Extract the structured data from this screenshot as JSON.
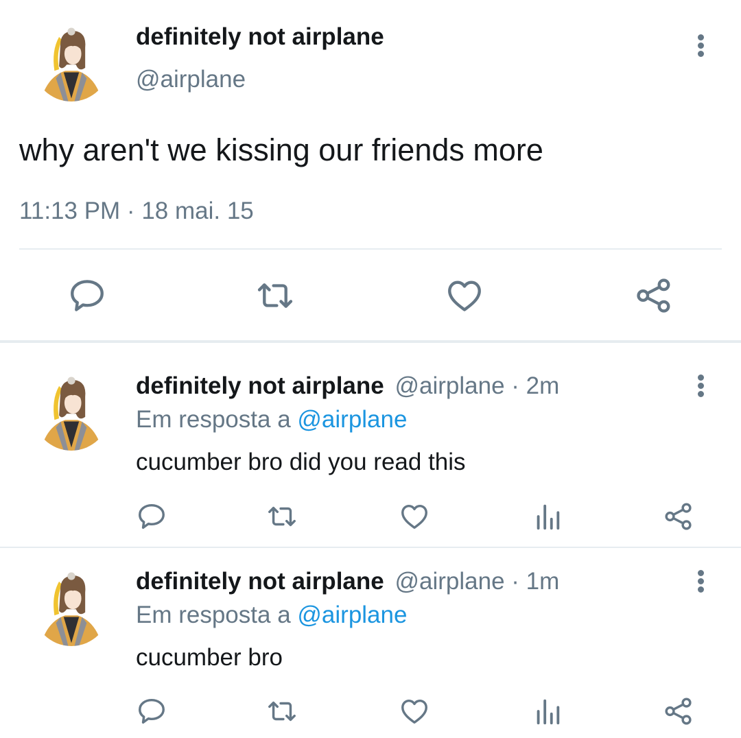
{
  "main_tweet": {
    "display_name": "definitely not airplane",
    "handle": "@airplane",
    "text": "why aren't we kissing our friends more",
    "timestamp": "11:13 PM · 18 mai. 15",
    "actions": [
      "reply-icon",
      "retweet-icon",
      "like-icon",
      "share-icon"
    ]
  },
  "replies": [
    {
      "display_name": "definitely not airplane",
      "handle_time": "@airplane · 2m",
      "reply_prefix": "Em resposta a",
      "reply_to": "@airplane",
      "text": "cucumber bro did you read this",
      "actions": [
        "reply-icon",
        "retweet-icon",
        "like-icon",
        "analytics-icon",
        "share-icon"
      ]
    },
    {
      "display_name": "definitely not airplane",
      "handle_time": "@airplane · 1m",
      "reply_prefix": "Em resposta a",
      "reply_to": "@airplane",
      "text": "cucumber bro",
      "actions": [
        "reply-icon",
        "retweet-icon",
        "like-icon",
        "analytics-icon",
        "share-icon"
      ]
    }
  ],
  "colors": {
    "text": "#14171a",
    "muted": "#657786",
    "link": "#1b95e0",
    "divider": "#e6ecf0"
  }
}
